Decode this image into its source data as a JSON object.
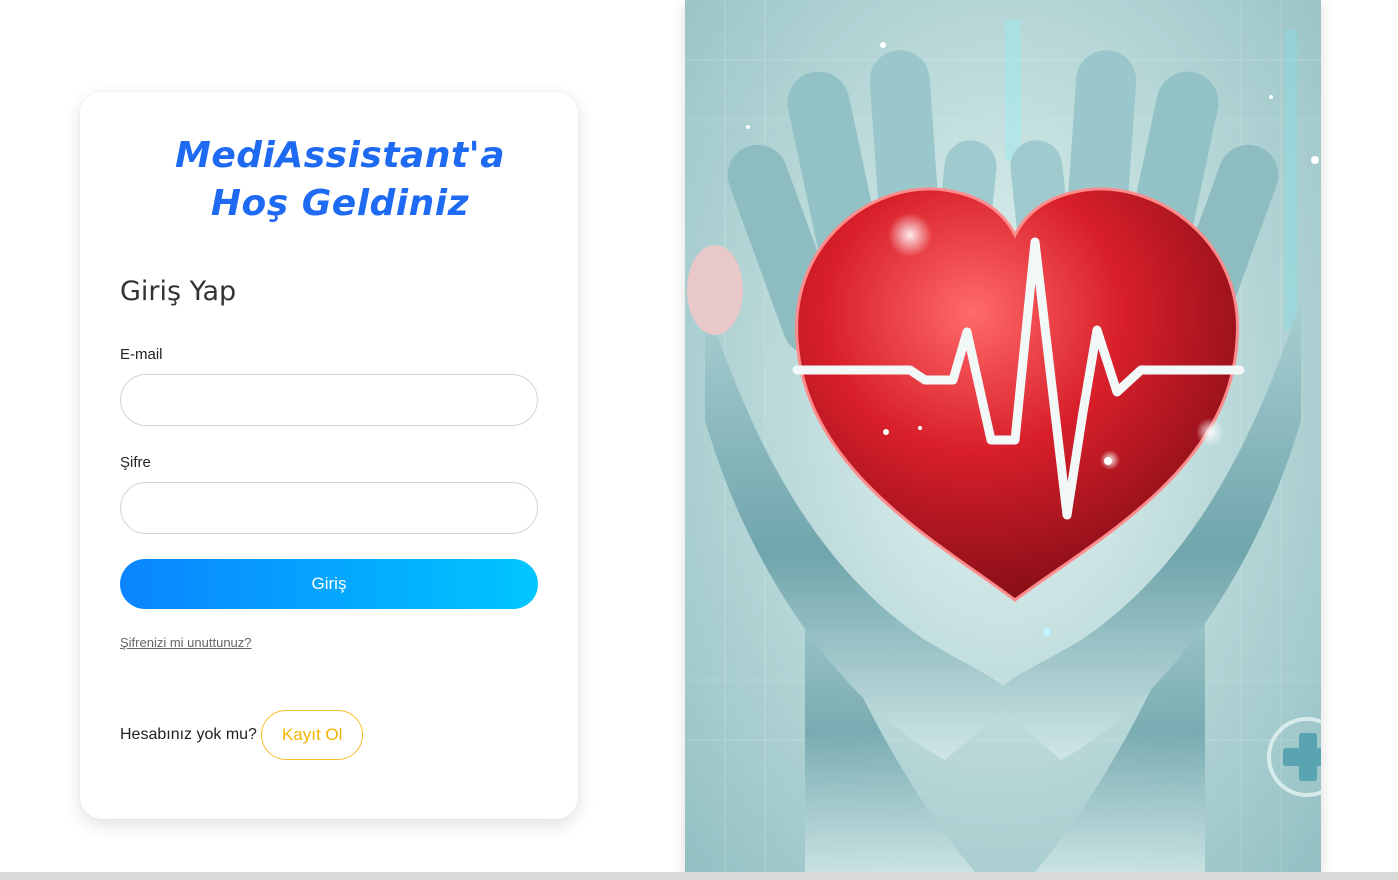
{
  "brand": {
    "title_line1": "MediAssistant'a",
    "title_line2": "Hoş Geldiniz"
  },
  "login": {
    "heading": "Giriş Yap",
    "email_label": "E-mail",
    "email_value": "",
    "email_placeholder": "",
    "password_label": "Şifre",
    "password_value": "",
    "password_placeholder": "",
    "submit_label": "Giriş",
    "forgot_link": "Şifrenizi mi unuttunuz?"
  },
  "signup": {
    "prompt": "Hesabınız yok mu?",
    "button_label": "Kayıt Ol"
  },
  "hero": {
    "image_name": "heart-in-hands-illustration"
  },
  "colors": {
    "brand_blue": "#1f6af2",
    "button_gradient_start": "#0a84ff",
    "button_gradient_end": "#00c6ff",
    "signup_accent": "#f0b400",
    "heart_red": "#d81f2a"
  }
}
